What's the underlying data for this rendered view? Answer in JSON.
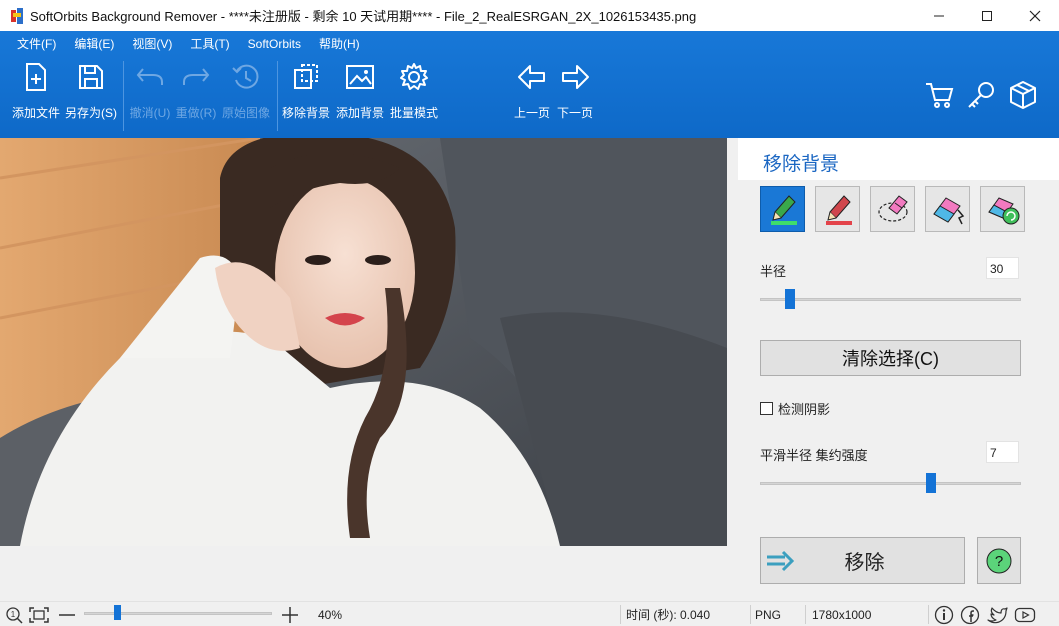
{
  "window": {
    "title": "SoftOrbits Background Remover - ****未注册版 - 剩余 10 天试用期**** - File_2_RealESRGAN_2X_1026153435.png",
    "minimize": "—",
    "maximize": "☐",
    "close": "✕"
  },
  "menu": [
    "文件(F)",
    "编辑(E)",
    "视图(V)",
    "工具(T)",
    "SoftOrbits",
    "帮助(H)"
  ],
  "toolbar": {
    "add_file": "添加文件",
    "save_as": "另存为(S)",
    "undo": "撤消(U)",
    "redo": "重做(R)",
    "original": "原始图像",
    "remove_bg": "移除背景",
    "add_bg": "添加背景",
    "batch": "批量模式",
    "prev": "上一页",
    "next": "下一页"
  },
  "panel": {
    "title": "移除背景",
    "brushes": [
      "keep-brush",
      "remove-brush",
      "eraser-lasso",
      "auto-brush",
      "refresh-brush"
    ],
    "radius_label": "半径",
    "radius_value": "30",
    "radius_fraction": 0.1,
    "clear_button": "清除选择(C)",
    "detect_shadow": "检测阴影",
    "detect_shadow_checked": false,
    "smooth_label": "平滑半径 集约强度",
    "smooth_value": "7",
    "smooth_fraction": 0.66,
    "remove_button": "移除",
    "help_button": "?"
  },
  "status": {
    "zoom": "40%",
    "time": "时间 (秒): 0.040",
    "format": "PNG",
    "size": "1780x1000"
  },
  "colors": {
    "ribbon": "#1173d4",
    "accent": "#1a66c2",
    "slider": "#1473d6"
  }
}
